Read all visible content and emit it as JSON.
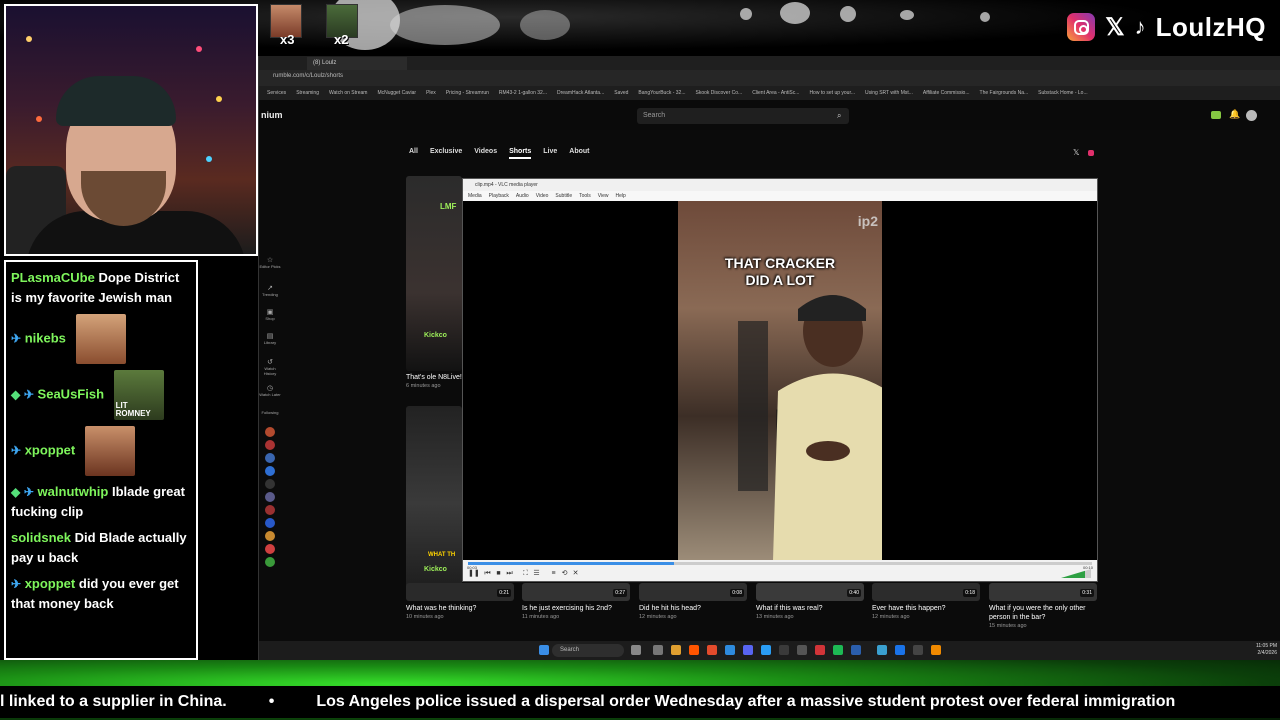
{
  "overlay": {
    "handle": "LoulzHQ",
    "emote_counts": [
      "x3",
      "x2"
    ],
    "ticker": {
      "item_1": "l linked to a supplier in China.",
      "separator": "•",
      "item_2": "Los Angeles police issued a dispersal order Wednesday after a massive student protest over federal immigration"
    }
  },
  "chat": {
    "messages": [
      {
        "user": "PLasmaCUbe",
        "text": "Dope District is my favorite Jewish man"
      },
      {
        "user": "nikebs",
        "text": ""
      },
      {
        "user": "SeaUsFish",
        "text": ""
      },
      {
        "user": "xpoppet",
        "text": ""
      },
      {
        "user": "walnutwhip",
        "text": "Iblade great fucking clip"
      },
      {
        "user": "solidsnek",
        "text": "Did Blade actually pay u back"
      },
      {
        "user": "xpoppet",
        "text": "did you ever get that money back"
      }
    ],
    "emote_label_seausfish": "LIT ROMNEY"
  },
  "browser": {
    "tab_title": "(8) Loulz",
    "url": "rumble.com/c/Loulz/shorts",
    "bookmarks": [
      "Services",
      "Streaming",
      "Watch on Stream",
      "McNugget Caviar",
      "Plex",
      "Pricing - Streamrun",
      "RM43-2 1-gallon 32...",
      "DreamHack Atlanta...",
      "Saved",
      "BangYourBuck - 32...",
      "Skook Discover Co...",
      "Client Area - AntiSc...",
      "How to set up your...",
      "Using SRT with Mst...",
      "Affiliate Commissio...",
      "The Fairgrounds Na...",
      "Substack Home - Lo..."
    ],
    "site_name": "nium",
    "search_placeholder": "Search",
    "nav_tabs": [
      "All",
      "Exclusive",
      "Videos",
      "Shorts",
      "Live",
      "About"
    ],
    "active_tab": "Shorts",
    "sidebar_labels": [
      "Editor Picks",
      "Trending",
      "Shop",
      "Library",
      "Watch History",
      "Watch Later",
      "Following"
    ],
    "shorts_left": [
      {
        "title": "That's ole N8Live!",
        "time": "6 minutes ago"
      }
    ],
    "shorts_row": [
      {
        "title": "What was he thinking?",
        "time": "10 minutes ago",
        "duration": "0:21"
      },
      {
        "title": "Is he just exercising his 2nd?",
        "time": "11 minutes ago",
        "duration": "0:27"
      },
      {
        "title": "Did he hit his head?",
        "time": "12 minutes ago",
        "duration": "0:08"
      },
      {
        "title": "What if this was real?",
        "time": "13 minutes ago",
        "duration": "0:40"
      },
      {
        "title": "Ever have this happen?",
        "time": "12 minutes ago",
        "duration": "0:18"
      },
      {
        "title": "What if you were the only other person in the bar?",
        "time": "15 minutes ago",
        "duration": "0:31"
      }
    ],
    "thumb_texts": [
      "LMF",
      "Kickco",
      "WHAT TH",
      "Kickco"
    ]
  },
  "vlc": {
    "title": "clip.mp4 - VLC media player",
    "menu": [
      "Media",
      "Playback",
      "Audio",
      "Video",
      "Subtitle",
      "Tools",
      "View",
      "Help"
    ],
    "caption_line1": "THAT CRACKER",
    "caption_line2": "DID A LOT",
    "watermark": "ip2",
    "time_elapsed": "00:03",
    "time_total": "00:10",
    "progress": 0.33
  },
  "taskbar": {
    "search": "Search",
    "time": "11:05 PM",
    "date": "2/4/2026"
  },
  "colors": {
    "chat_user": "#7ef55c",
    "accent_green": "#36e02a",
    "rumble_green": "#85c742"
  }
}
